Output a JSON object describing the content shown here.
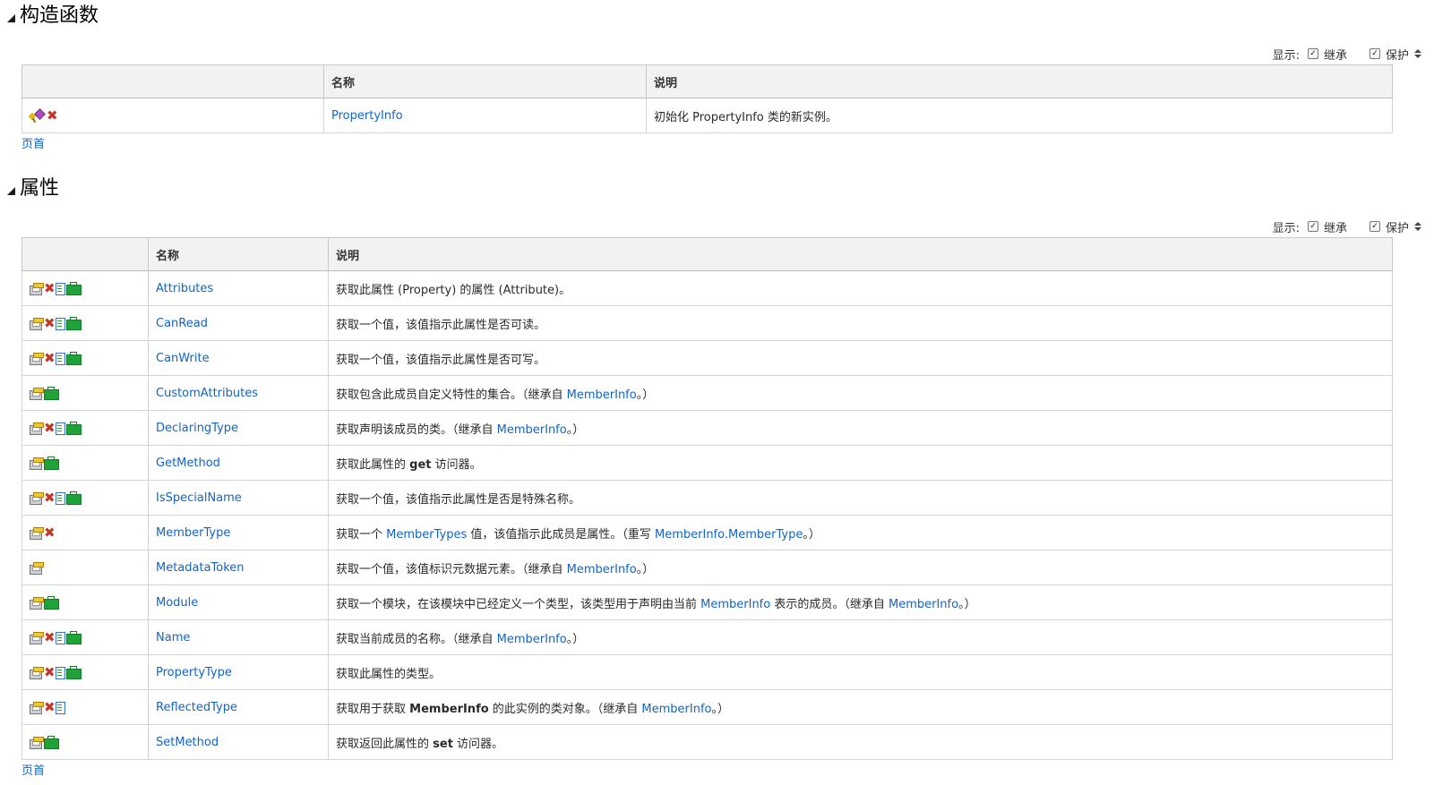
{
  "colors": {
    "link": "#1364c4",
    "header_bg": "#f2f2f2",
    "border": "#d4d4d4"
  },
  "constructors": {
    "title": "构造函数",
    "options": {
      "show_label": "显示:",
      "inherited_label": "继承",
      "protected_label": "保护"
    },
    "columns": [
      "",
      "名称",
      "说明"
    ],
    "rows": [
      {
        "icons": [
          "constructor-icon",
          "static-x-icon"
        ],
        "name": "PropertyInfo",
        "desc": [
          {
            "t": "初始化 PropertyInfo 类的新实例。"
          }
        ]
      }
    ],
    "top_link": "页首"
  },
  "properties": {
    "title": "属性",
    "options": {
      "show_label": "显示:",
      "inherited_label": "继承",
      "protected_label": "保护"
    },
    "columns": [
      "",
      "名称",
      "说明"
    ],
    "rows": [
      {
        "icons": [
          "property-icon",
          "static-x-icon",
          "xna-doc-icon",
          "portable-bag-icon"
        ],
        "name": "Attributes",
        "desc": [
          {
            "t": "获取此属性 (Property) 的属性 (Attribute)。"
          }
        ]
      },
      {
        "icons": [
          "property-icon",
          "static-x-icon",
          "xna-doc-icon",
          "portable-bag-icon"
        ],
        "name": "CanRead",
        "desc": [
          {
            "t": "获取一个值，该值指示此属性是否可读。"
          }
        ]
      },
      {
        "icons": [
          "property-icon",
          "static-x-icon",
          "xna-doc-icon",
          "portable-bag-icon"
        ],
        "name": "CanWrite",
        "desc": [
          {
            "t": "获取一个值，该值指示此属性是否可写。"
          }
        ]
      },
      {
        "icons": [
          "property-icon",
          "portable-bag-icon"
        ],
        "name": "CustomAttributes",
        "desc": [
          {
            "t": "获取包含此成员自定义特性的集合。（继承自 "
          },
          {
            "l": "MemberInfo"
          },
          {
            "t": "。）"
          }
        ]
      },
      {
        "icons": [
          "property-icon",
          "static-x-icon",
          "xna-doc-icon",
          "portable-bag-icon"
        ],
        "name": "DeclaringType",
        "desc": [
          {
            "t": "获取声明该成员的类。（继承自 "
          },
          {
            "l": "MemberInfo"
          },
          {
            "t": "。）"
          }
        ]
      },
      {
        "icons": [
          "property-icon",
          "portable-bag-icon"
        ],
        "name": "GetMethod",
        "desc": [
          {
            "t": "获取此属性的 "
          },
          {
            "b": "get"
          },
          {
            "t": " 访问器。"
          }
        ]
      },
      {
        "icons": [
          "property-icon",
          "static-x-icon",
          "xna-doc-icon",
          "portable-bag-icon"
        ],
        "name": "IsSpecialName",
        "desc": [
          {
            "t": "获取一个值，该值指示此属性是否是特殊名称。"
          }
        ]
      },
      {
        "icons": [
          "property-icon",
          "static-x-icon"
        ],
        "name": "MemberType",
        "desc": [
          {
            "t": "获取一个 "
          },
          {
            "l": "MemberTypes"
          },
          {
            "t": " 值，该值指示此成员是属性。（重写 "
          },
          {
            "l": "MemberInfo.MemberType"
          },
          {
            "t": "。）"
          }
        ]
      },
      {
        "icons": [
          "property-icon"
        ],
        "name": "MetadataToken",
        "desc": [
          {
            "t": "获取一个值，该值标识元数据元素。（继承自 "
          },
          {
            "l": "MemberInfo"
          },
          {
            "t": "。）"
          }
        ]
      },
      {
        "icons": [
          "property-icon",
          "portable-bag-icon"
        ],
        "name": "Module",
        "desc": [
          {
            "t": "获取一个模块，在该模块中已经定义一个类型，该类型用于声明由当前 "
          },
          {
            "l": "MemberInfo"
          },
          {
            "t": " 表示的成员。（继承自 "
          },
          {
            "l": "MemberInfo"
          },
          {
            "t": "。）"
          }
        ]
      },
      {
        "icons": [
          "property-icon",
          "static-x-icon",
          "xna-doc-icon",
          "portable-bag-icon"
        ],
        "name": "Name",
        "desc": [
          {
            "t": "获取当前成员的名称。（继承自 "
          },
          {
            "l": "MemberInfo"
          },
          {
            "t": "。）"
          }
        ]
      },
      {
        "icons": [
          "property-icon",
          "static-x-icon",
          "xna-doc-icon",
          "portable-bag-icon"
        ],
        "name": "PropertyType",
        "desc": [
          {
            "t": "获取此属性的类型。"
          }
        ]
      },
      {
        "icons": [
          "property-icon",
          "static-x-icon",
          "xna-doc-icon"
        ],
        "name": "ReflectedType",
        "desc": [
          {
            "t": "获取用于获取 "
          },
          {
            "b": "MemberInfo"
          },
          {
            "t": " 的此实例的类对象。（继承自 "
          },
          {
            "l": "MemberInfo"
          },
          {
            "t": "。）"
          }
        ]
      },
      {
        "icons": [
          "property-icon",
          "portable-bag-icon"
        ],
        "name": "SetMethod",
        "desc": [
          {
            "t": "获取返回此属性的 "
          },
          {
            "b": "set"
          },
          {
            "t": " 访问器。"
          }
        ]
      }
    ],
    "top_link": "页首"
  }
}
